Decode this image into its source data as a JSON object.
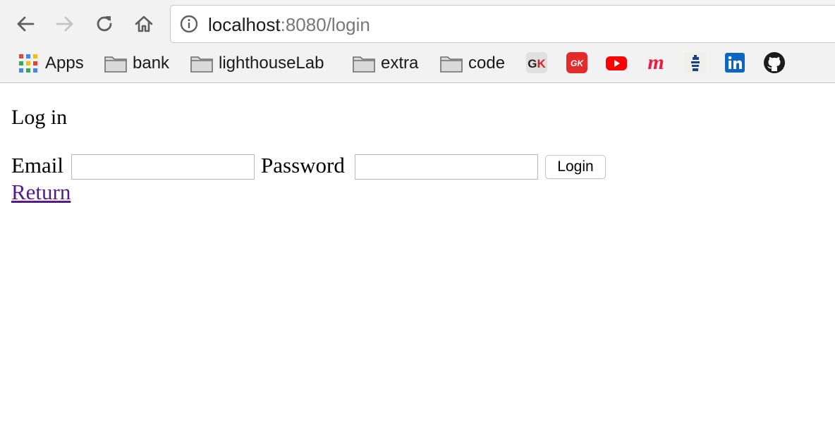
{
  "browser": {
    "url_host": "localhost",
    "url_rest": ":8080/login",
    "bookmarks": [
      {
        "label": "Apps",
        "icon": "apps-grid-icon"
      },
      {
        "label": "bank",
        "icon": "folder-icon"
      },
      {
        "label": "lighthouseLab",
        "icon": "folder-icon"
      },
      {
        "label": "extra",
        "icon": "folder-icon"
      },
      {
        "label": "code",
        "icon": "folder-icon"
      }
    ],
    "favicons": [
      {
        "name": "gk-favicon-icon",
        "text": "GK"
      },
      {
        "name": "gk-red-favicon-icon",
        "text": "GK"
      },
      {
        "name": "youtube-icon"
      },
      {
        "name": "meetup-icon",
        "text": "m"
      },
      {
        "name": "stacked-logo-icon"
      },
      {
        "name": "linkedin-icon",
        "text": "in"
      },
      {
        "name": "github-icon"
      }
    ]
  },
  "page": {
    "title": "Log in",
    "email_label": "Email",
    "email_value": "",
    "password_label": "Password",
    "password_value": "",
    "login_button": "Login",
    "return_link": "Return"
  },
  "colors": {
    "link_visited": "#551a8b",
    "youtube_red": "#ff0000",
    "linkedin_blue": "#0a66c2",
    "meetup_pink": "#ed1c40"
  }
}
